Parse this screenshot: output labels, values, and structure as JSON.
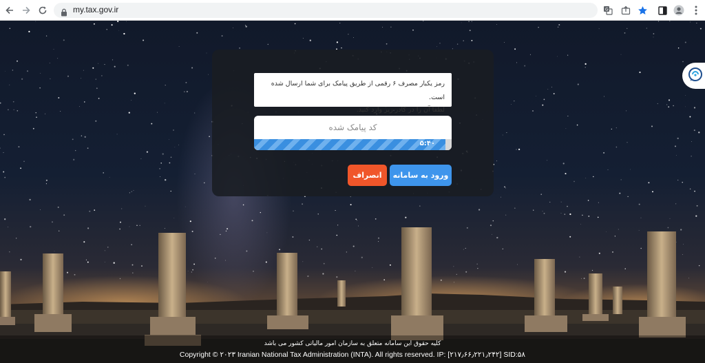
{
  "browser": {
    "url": "my.tax.gov.ir",
    "icons": [
      "back-icon",
      "forward-icon",
      "reload-icon",
      "lock-icon",
      "translate-icon",
      "share-icon",
      "bookmark-star-icon",
      "side-panel-icon",
      "profile-icon",
      "menu-icon"
    ]
  },
  "dialog": {
    "message_line1": "رمز یکبار مصرف ۶ رقمی از طریق پیامک برای شما ارسال شده است.",
    "message_line2": "لطفا آن را در کادر زیر وارد کنید.",
    "code_placeholder": "کد پیامک شده",
    "timer": "۵:۴۰",
    "timer_progress": 0.97,
    "login_button": "ورود به سامانه",
    "cancel_button": "انصراف"
  },
  "colors": {
    "login": "#3e95ec",
    "cancel": "#f0562a",
    "progress": "#3a8fe0"
  },
  "chat_widget": {
    "icon": "chat-support-icon"
  },
  "footer": {
    "rights_fa": "کلیه حقوق این سامانه متعلق به سازمان امور مالیاتی کشور می باشد",
    "copyright": "Copyright © ۲۰۲۳ Iranian National Tax Administration (INTA). All rights reserved. IP: [۲۱۷٫۶۶٫۲۲۱٫۲۴۲] SID:۵۸"
  }
}
